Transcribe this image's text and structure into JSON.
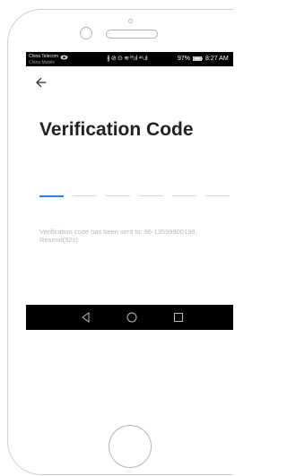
{
  "status_bar": {
    "carrier_primary": "China Telecom",
    "carrier_secondary": "China Mobile",
    "icons_text": "∦ ⊘ ⊙ ≋ ᴴ.ıl ⁴⁶.ıl",
    "battery_percent": "97%",
    "time": "8:27 AM"
  },
  "header": {
    "back_icon": "arrow-left-icon"
  },
  "page": {
    "title": "Verification Code"
  },
  "code_input": {
    "slot_count": 6,
    "active_slot": 0,
    "active_color": "#2f7de1",
    "inactive_color": "#d9d9d9"
  },
  "info": {
    "sent_text": "Verification code has been sent to: 86-13599900198.",
    "resend_text": "Resend(52s)"
  },
  "nav_bar": {
    "back_icon": "triangle-back-icon",
    "home_icon": "circle-home-icon",
    "recent_icon": "square-recent-apps-icon"
  },
  "colors": {
    "title": "#222222",
    "info_text": "#b9b9b9",
    "status_bar_bg": "#000000"
  }
}
